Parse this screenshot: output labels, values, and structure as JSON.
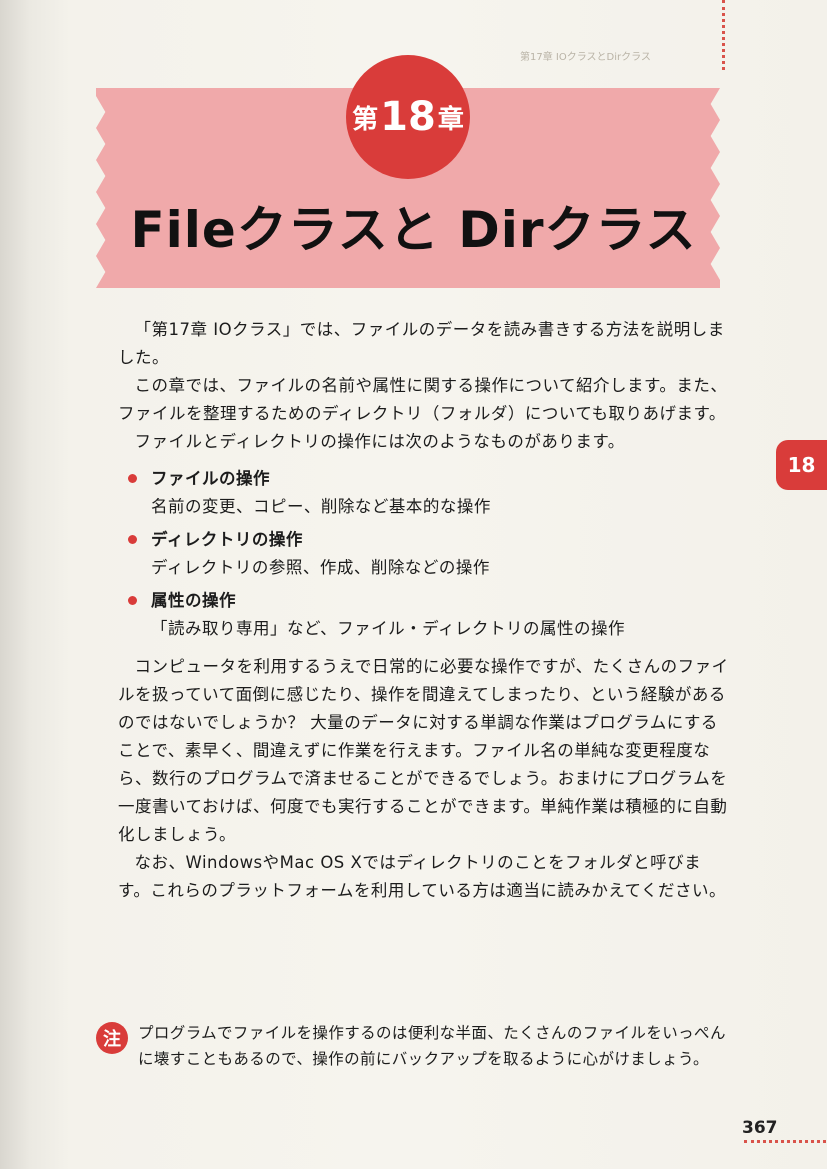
{
  "header": {
    "ghost_text": "第17章 IOクラスとDirクラス"
  },
  "chapter": {
    "prefix": "第",
    "number": "18",
    "suffix": "章"
  },
  "title": "Fileクラスと Dirクラス",
  "side_tab": "18",
  "paragraphs": {
    "p1": "「第17章 IOクラス」では、ファイルのデータを読み書きする方法を説明しました。",
    "p2": "この章では、ファイルの名前や属性に関する操作について紹介します。また、ファイルを整理するためのディレクトリ（フォルダ）についても取りあげます。",
    "p3": "ファイルとディレクトリの操作には次のようなものがあります。",
    "p4": "コンピュータを利用するうえで日常的に必要な操作ですが、たくさんのファイルを扱っていて面倒に感じたり、操作を間違えてしまったり、という経験があるのではないでしょうか？ 大量のデータに対する単調な作業はプログラムにすることで、素早く、間違えずに作業を行えます。ファイル名の単純な変更程度なら、数行のプログラムで済ませることができるでしょう。おまけにプログラムを一度書いておけば、何度でも実行することができます。単純作業は積極的に自動化しましょう。",
    "p5": "なお、WindowsやMac OS Xではディレクトリのことをフォルダと呼びます。これらのプラットフォームを利用している方は適当に読みかえてください。"
  },
  "list": [
    {
      "head": "ファイルの操作",
      "desc": "名前の変更、コピー、削除など基本的な操作"
    },
    {
      "head": "ディレクトリの操作",
      "desc": "ディレクトリの参照、作成、削除などの操作"
    },
    {
      "head": "属性の操作",
      "desc": "「読み取り専用」など、ファイル・ディレクトリの属性の操作"
    }
  ],
  "note": {
    "icon": "注",
    "text": "プログラムでファイルを操作するのは便利な半面、たくさんのファイルをいっぺんに壊すこともあるので、操作の前にバックアップを取るように心がけましょう。"
  },
  "page_number": "367",
  "colors": {
    "accent": "#d93c3a",
    "banner": "#f0a9aa"
  }
}
